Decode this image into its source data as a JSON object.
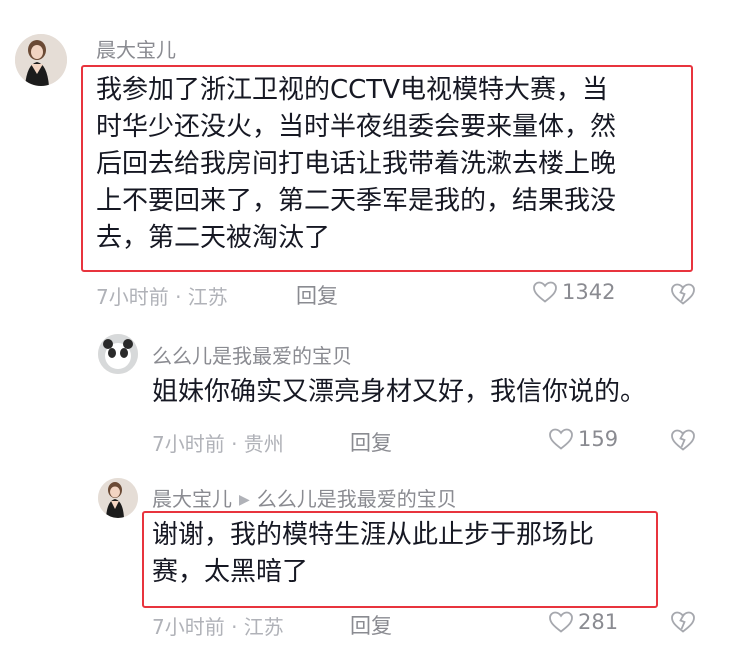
{
  "comments": [
    {
      "username": "晨大宝儿",
      "text": [
        "我参加了浙江卫视的CCTV电视模特大赛，当",
        "时华少还没火，当时半夜组委会要来量体，然",
        "后回去给我房间打电话让我带着洗漱去楼上晚",
        "上不要回来了，第二天季军是我的，结果我没",
        "去，第二天被淘汰了"
      ],
      "meta": "7小时前 · 江苏",
      "reply_label": "回复",
      "likes": "1342"
    },
    {
      "username": "么么儿是我最爱的宝贝",
      "text": [
        "姐妹你确实又漂亮身材又好，我信你说的。"
      ],
      "meta": "7小时前 · 贵州",
      "reply_label": "回复",
      "likes": "159"
    },
    {
      "username": "晨大宝儿",
      "reply_to": "么么儿是我最爱的宝贝",
      "text": [
        "谢谢，我的模特生涯从此止步于那场比",
        "赛，太黑暗了"
      ],
      "meta": "7小时前 · 江苏",
      "reply_label": "回复",
      "likes": "281"
    }
  ],
  "colors": {
    "highlight": "#e8343e",
    "meta": "#b0b2b8",
    "username": "#8a8b91"
  },
  "icons": [
    "heart-outline-icon",
    "dislike-icon",
    "reply-arrow-icon"
  ]
}
